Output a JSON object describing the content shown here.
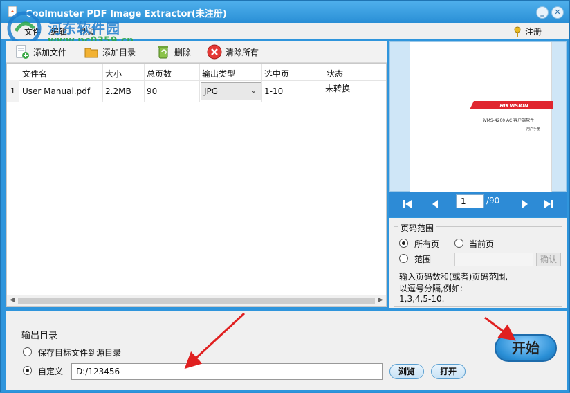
{
  "titlebar": {
    "title": "Coolmuster PDF Image Extractor(未注册)",
    "minimize_glyph": "_",
    "close_glyph": "✕"
  },
  "menu": {
    "file": "文件",
    "edit": "编辑",
    "help": "帮助",
    "register": "注册"
  },
  "watermark": {
    "line1": "河东软件园",
    "line2": "www.pc0359.cn"
  },
  "toolbar": {
    "add_file": "添加文件",
    "add_folder": "添加目录",
    "delete": "删除",
    "clear_all": "清除所有"
  },
  "grid": {
    "headers": [
      "文件名",
      "大小",
      "总页数",
      "输出类型",
      "选中页",
      "状态"
    ],
    "rows": [
      {
        "index": "1",
        "filename": "User Manual.pdf",
        "size": "2.2MB",
        "pages": "90",
        "output_type": "JPG",
        "selected_pages": "1-10",
        "status": "未转换"
      }
    ]
  },
  "preview": {
    "brand": "HIKVISION",
    "line1": "iVMS-4200 AC 客户端软件",
    "line2": "用户手册"
  },
  "nav": {
    "current_page": "1",
    "total": "/90"
  },
  "range": {
    "legend": "页码范围",
    "all_pages": "所有页",
    "current_page": "当前页",
    "custom_range": "范围",
    "confirm": "确认",
    "hint1": "输入页码数和(或者)页码范围,",
    "hint2": "以逗号分隔,例如:",
    "hint3": "1,3,4,5-10."
  },
  "output": {
    "title": "输出目录",
    "save_to_source": "保存目标文件到源目录",
    "custom": "自定义",
    "path": "D:/123456",
    "browse": "浏览",
    "open": "打开",
    "start": "开始"
  },
  "colors": {
    "accent": "#2a8fd6",
    "arrow": "#e02020",
    "preview_red": "#e0262f"
  }
}
